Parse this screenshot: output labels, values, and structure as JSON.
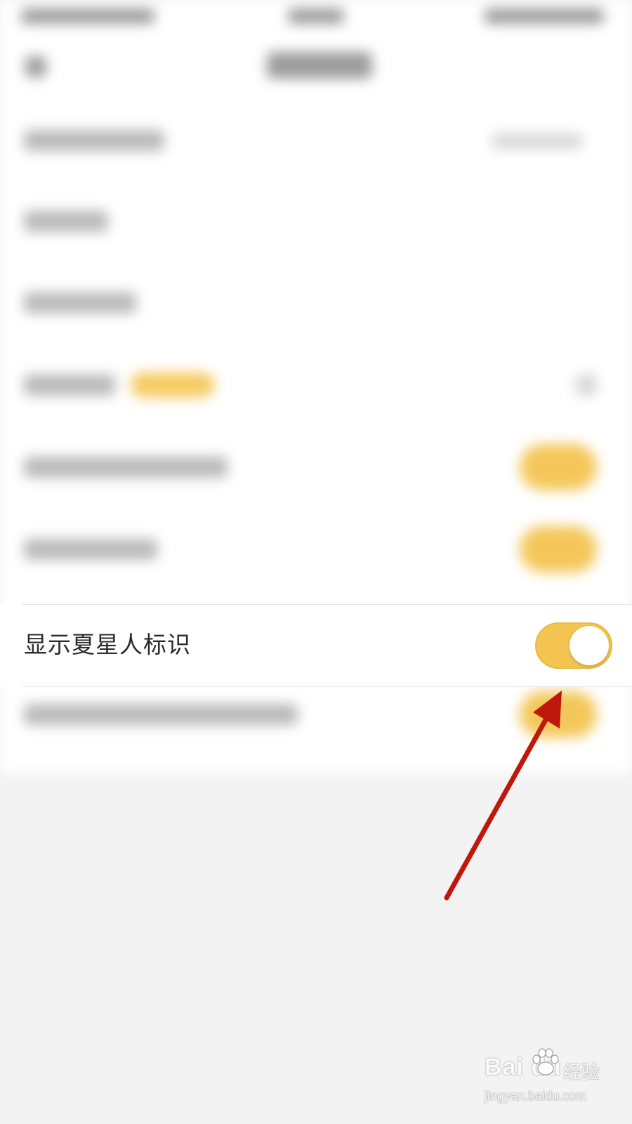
{
  "setting_row": {
    "label": "显示夏星人标识",
    "toggle_on": true
  },
  "colors": {
    "toggle_track": "#f3c452",
    "toggle_knob": "#ffffff",
    "arrow": "#c0170c",
    "background": "#f3f3f3"
  },
  "watermark": {
    "logo": "Bai du",
    "logo_cn": "经验",
    "url": "jingyan.baidu.com"
  }
}
